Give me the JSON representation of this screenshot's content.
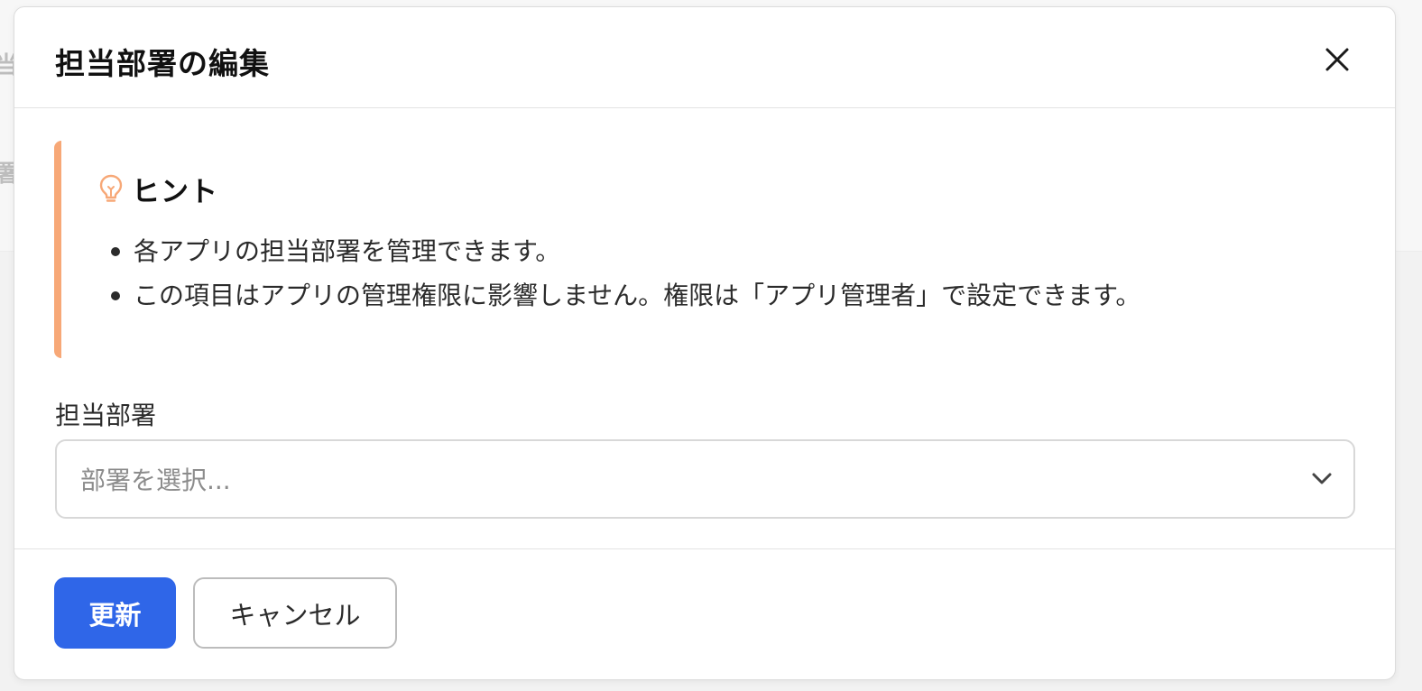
{
  "background": {
    "fragment_1": "当",
    "fragment_2": "署"
  },
  "modal": {
    "title": "担当部署の編集",
    "close_icon": "close-icon"
  },
  "hint": {
    "accent_color": "#f7a877",
    "icon": "lightbulb-icon",
    "title": "ヒント",
    "items": [
      "各アプリの担当部署を管理できます。",
      "この項目はアプリの管理権限に影響しません。権限は「アプリ管理者」で設定できます。"
    ]
  },
  "department_field": {
    "label": "担当部署",
    "placeholder": "部署を選択...",
    "chevron_icon": "chevron-down-icon"
  },
  "footer": {
    "update_label": "更新",
    "cancel_label": "キャンセル",
    "primary_color": "#2f66e8"
  }
}
